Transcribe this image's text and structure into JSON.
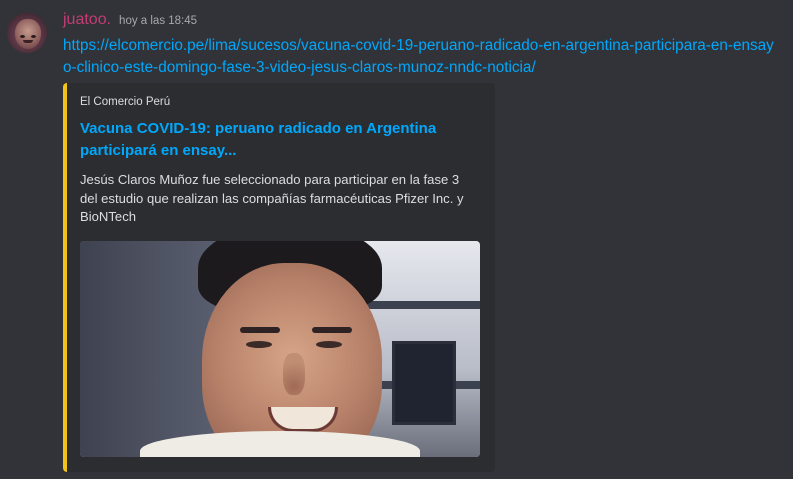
{
  "message": {
    "author": "juatoo.",
    "timestamp": "hoy a las 18:45",
    "link": "https://elcomercio.pe/lima/sucesos/vacuna-covid-19-peruano-radicado-en-argentina-participara-en-ensayo-clinico-este-domingo-fase-3-video-jesus-claros-munoz-nndc-noticia/"
  },
  "embed": {
    "provider": "El Comercio Perú",
    "title": "Vacuna COVID-19: peruano radicado en Argentina participará en ensay...",
    "description": "Jesús Claros Muñoz fue seleccionado para participar en la fase 3 del estudio que realizan las compañías farmacéuticas Pfizer Inc. y BioNTech",
    "accent_color": "#f0c419"
  },
  "colors": {
    "background": "#313338",
    "embed_background": "#2b2d31",
    "username": "#c43d74",
    "link": "#00a8fc"
  }
}
